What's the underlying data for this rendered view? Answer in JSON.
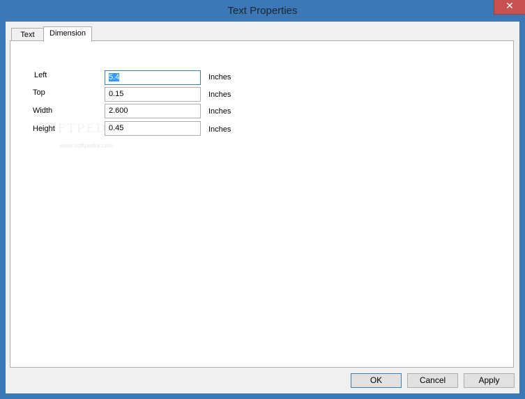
{
  "window": {
    "title": "Text Properties",
    "close_glyph": "✕"
  },
  "tabs": [
    {
      "label": "Text",
      "active": false
    },
    {
      "label": "Dimension",
      "active": true
    }
  ],
  "fields": [
    {
      "label": "Left",
      "value": "5.4",
      "unit": "Inches"
    },
    {
      "label": "Top",
      "value": "0.15",
      "unit": "Inches"
    },
    {
      "label": "Width",
      "value": "2.600",
      "unit": "Inches"
    },
    {
      "label": "Height",
      "value": "0.45",
      "unit": "Inches"
    }
  ],
  "buttons": {
    "ok": "OK",
    "cancel": "Cancel",
    "apply": "Apply"
  },
  "watermark": {
    "brand": "SOFTPEDIA",
    "url": "www.softpedia.com"
  },
  "colors": {
    "frame": "#3c78b5",
    "close": "#c75050",
    "selection": "#3399ff"
  }
}
